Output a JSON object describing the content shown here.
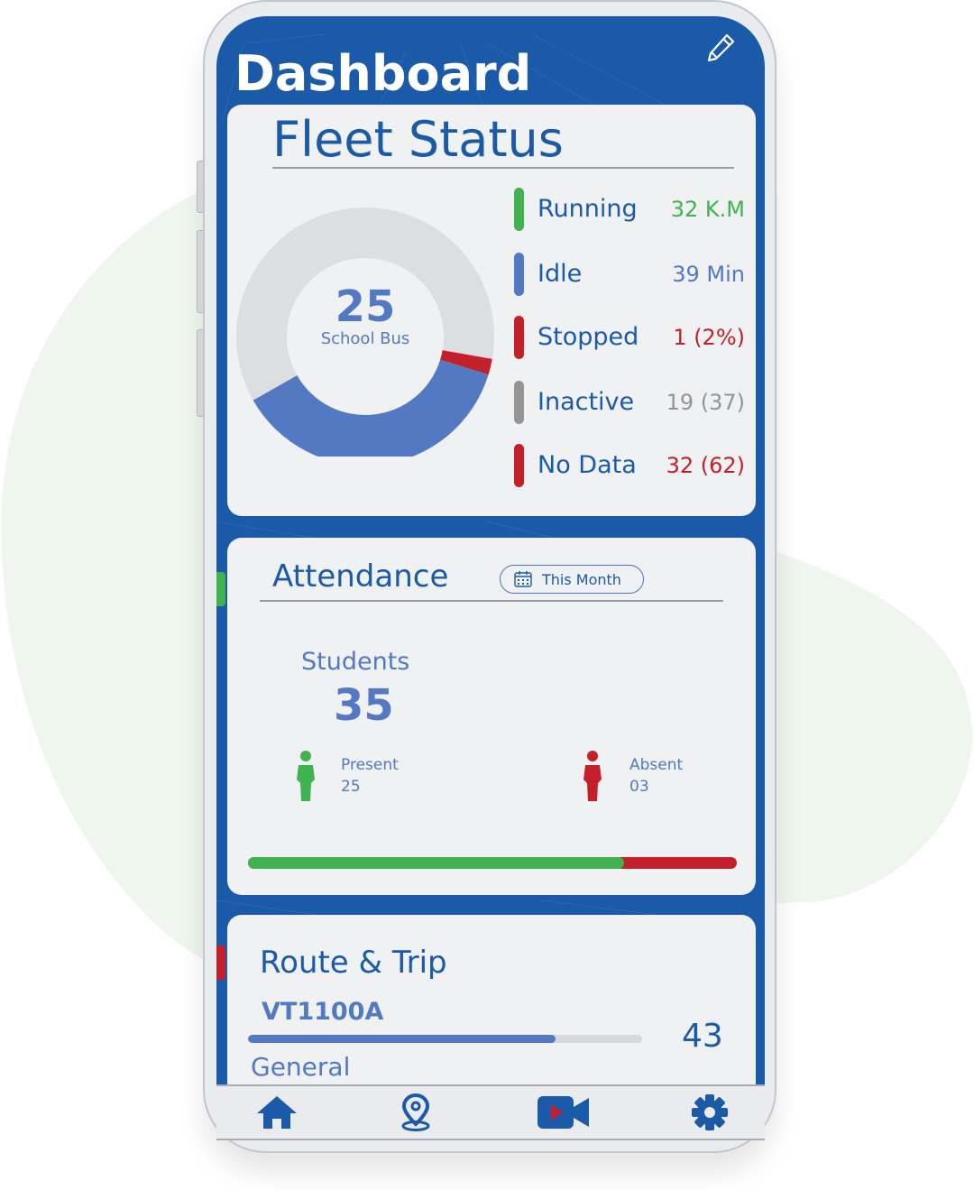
{
  "colors": {
    "brand_blue": "#1b5aa8",
    "light_blue": "#5279c2",
    "green": "#40b350",
    "red": "#c4202b",
    "gray": "#949494",
    "card_bg": "#eff1f3",
    "blob": "#eff6ee"
  },
  "header": {
    "title": "Dashboard",
    "edit_icon": "pencil-icon"
  },
  "fleet_status": {
    "title": "Fleet Status",
    "total": "25",
    "total_label": "School Bus",
    "legend": [
      {
        "label": "Running",
        "value": "32 K.M",
        "color": "#40b350"
      },
      {
        "label": "Idle",
        "value": "39 Min",
        "color": "#5279c2"
      },
      {
        "label": "Stopped",
        "value": "1 (2%)",
        "color": "#c4202b"
      },
      {
        "label": "Inactive",
        "value": "19 (37)",
        "color": "#949494"
      },
      {
        "label": "No Data",
        "value": "32 (62)",
        "color": "#c4202b"
      }
    ]
  },
  "chart_data": {
    "type": "pie",
    "title": "Fleet Status",
    "center_text": "25 School Bus",
    "slices": [
      {
        "name": "Stopped",
        "value": 2,
        "color": "#c4202b"
      },
      {
        "name": "Idle",
        "value": 37,
        "color": "#5279c2"
      },
      {
        "name": "Inactive / Other",
        "value": 61,
        "color": "#dcdee1"
      }
    ],
    "start_angle_deg": 100,
    "units": "percent"
  },
  "attendance": {
    "title": "Attendance",
    "filter_label": "This Month",
    "filter_icon": "calendar-icon",
    "students_label": "Students",
    "students_count": "35",
    "present_label": "Present",
    "present_value": "25",
    "absent_label": "Absent",
    "absent_value": "03",
    "present_fraction": 0.77
  },
  "route_trip": {
    "title": "Route & Trip",
    "route_id": "VT1100A",
    "route_value": "43",
    "route_progress_fraction": 0.78,
    "next_label": "General"
  },
  "bottom_nav": [
    {
      "name": "home",
      "icon": "home-icon"
    },
    {
      "name": "location",
      "icon": "location-pin-icon"
    },
    {
      "name": "video",
      "icon": "video-camera-icon"
    },
    {
      "name": "settings",
      "icon": "gear-icon"
    }
  ]
}
